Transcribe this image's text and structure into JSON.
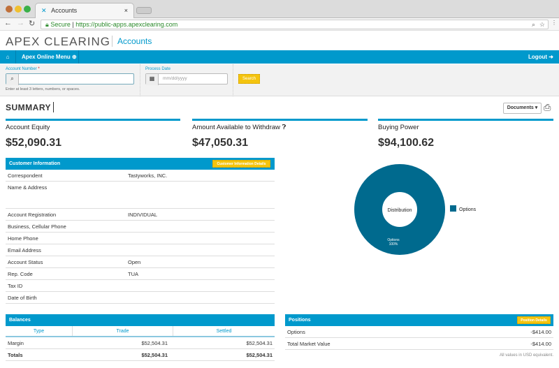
{
  "browser": {
    "tab_title": "Accounts",
    "secure_label": "Secure",
    "url": "https://public-apps.apexclearing.com"
  },
  "header": {
    "logo": "APEX CLEARING",
    "app_title": "Accounts"
  },
  "nav": {
    "menu_label": "Apex Online Menu",
    "logout_label": "Logout"
  },
  "search": {
    "account_label": "Account Number",
    "required": "*",
    "account_value": "",
    "hint": "Enter at least 3 letters, numbers, or spaces.",
    "date_label": "Process Date",
    "date_placeholder": "mm/dd/yyyy",
    "search_button": "Search"
  },
  "summary": {
    "title": "SUMMARY",
    "documents_button": "Documents ▾"
  },
  "metrics": [
    {
      "label": "Account Equity",
      "value": "$52,090.31"
    },
    {
      "label": "Amount Available to Withdraw",
      "value": "$47,050.31"
    },
    {
      "label": "Buying Power",
      "value": "$94,100.62"
    }
  ],
  "customer": {
    "title": "Customer Information",
    "details_button": "Customer Information Details",
    "rows": [
      {
        "label": "Correspondent",
        "value": "Tastyworks, INC."
      },
      {
        "label": "Name & Address",
        "value": ""
      },
      {
        "label": "Account Registration",
        "value": "INDIVIDUAL"
      },
      {
        "label": "Business, Cellular Phone",
        "value": ""
      },
      {
        "label": "Home Phone",
        "value": ""
      },
      {
        "label": "Email Address",
        "value": ""
      },
      {
        "label": "Account Status",
        "value": "Open"
      },
      {
        "label": "Rep. Code",
        "value": "TUA"
      },
      {
        "label": "Tax ID",
        "value": ""
      },
      {
        "label": "Date of Birth",
        "value": ""
      }
    ]
  },
  "chart_data": {
    "type": "pie",
    "title": "Distribution",
    "categories": [
      "Options"
    ],
    "values": [
      100
    ],
    "labels": [
      "Options",
      "100%"
    ],
    "legend": "right",
    "colors": [
      "#006a8e"
    ]
  },
  "balances": {
    "title": "Balances",
    "headers": [
      "Type",
      "Trade",
      "Settled"
    ],
    "rows": [
      [
        "Margin",
        "$52,504.31",
        "$52,504.31"
      ],
      [
        "Totals",
        "$52,504.31",
        "$52,504.31"
      ]
    ]
  },
  "positions": {
    "title": "Positions",
    "details_button": "Position Details",
    "rows": [
      [
        "Options",
        "-$414.00"
      ],
      [
        "Total Market Value",
        "-$414.00"
      ]
    ],
    "footnote": "All values in USD equivalent."
  }
}
